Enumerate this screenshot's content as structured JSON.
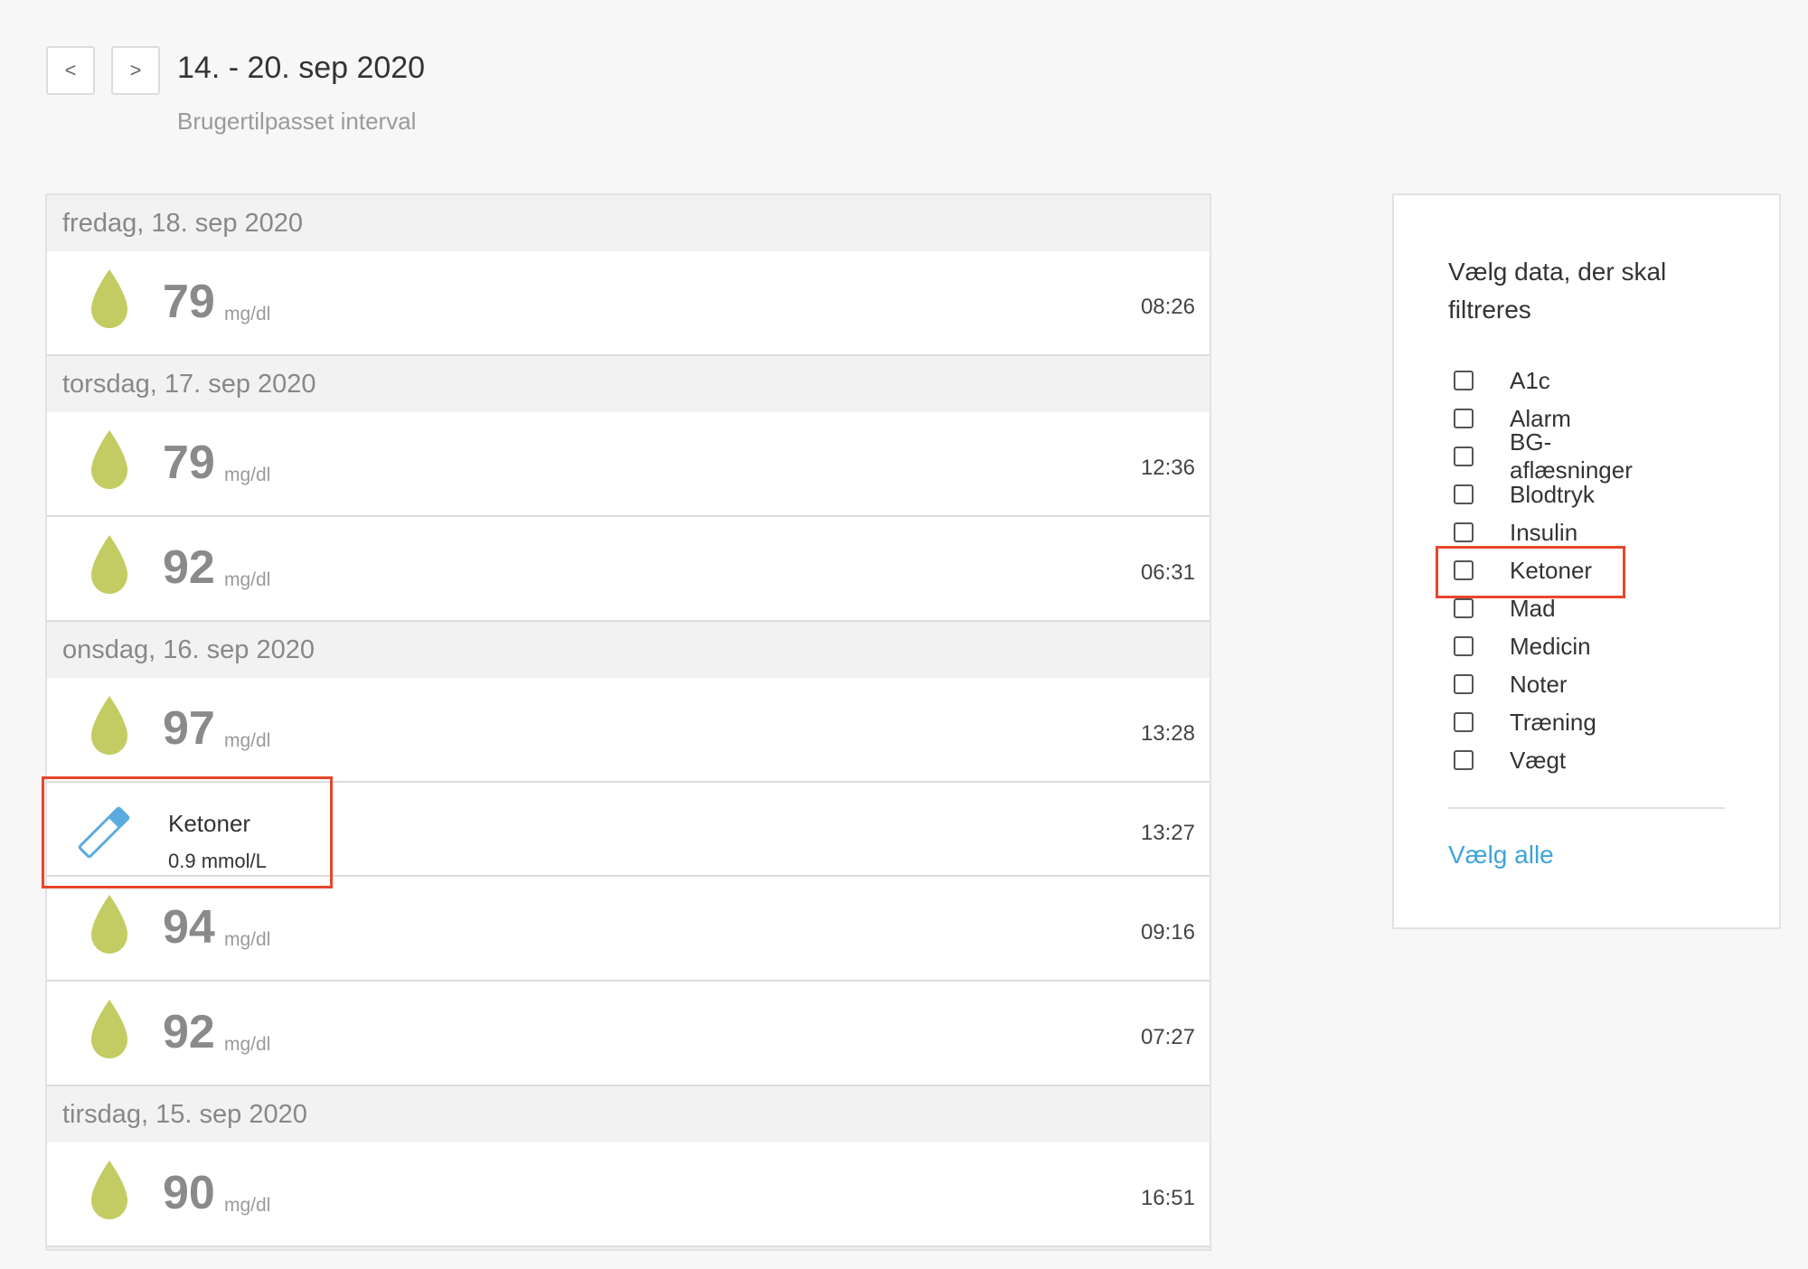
{
  "header": {
    "prev_label": "<",
    "next_label": ">",
    "range_title": "14. - 20. sep 2020",
    "range_subtitle": "Brugertilpasset interval"
  },
  "log": {
    "days": [
      {
        "label": "fredag, 18. sep 2020",
        "entries": [
          {
            "type": "bg",
            "value": "79",
            "unit": "mg/dl",
            "time": "08:26"
          }
        ]
      },
      {
        "label": "torsdag, 17. sep 2020",
        "entries": [
          {
            "type": "bg",
            "value": "79",
            "unit": "mg/dl",
            "time": "12:36"
          },
          {
            "type": "bg",
            "value": "92",
            "unit": "mg/dl",
            "time": "06:31"
          }
        ]
      },
      {
        "label": "onsdag, 16. sep 2020",
        "entries": [
          {
            "type": "bg",
            "value": "97",
            "unit": "mg/dl",
            "time": "13:28"
          },
          {
            "type": "ketone",
            "name": "Ketoner",
            "value": "0.9 mmol/L",
            "time": "13:27"
          },
          {
            "type": "bg",
            "value": "94",
            "unit": "mg/dl",
            "time": "09:16"
          },
          {
            "type": "bg",
            "value": "92",
            "unit": "mg/dl",
            "time": "07:27"
          }
        ]
      },
      {
        "label": "tirsdag, 15. sep 2020",
        "entries": [
          {
            "type": "bg",
            "value": "90",
            "unit": "mg/dl",
            "time": "16:51"
          }
        ]
      }
    ]
  },
  "filter": {
    "title": "Vælg data, der skal filtreres",
    "options": [
      "A1c",
      "Alarm",
      "BG-aflæsninger",
      "Blodtryk",
      "Insulin",
      "Ketoner",
      "Mad",
      "Medicin",
      "Noter",
      "Træning",
      "Vægt"
    ],
    "select_all": "Vælg alle"
  },
  "icons": {
    "bg_entry": "blood-drop-icon",
    "ketone_entry": "ketone-strip-icon"
  },
  "colors": {
    "drop": "#c3cc62",
    "ketone": "#5aace0",
    "highlight": "#e8452c",
    "link": "#3ea3dc"
  }
}
